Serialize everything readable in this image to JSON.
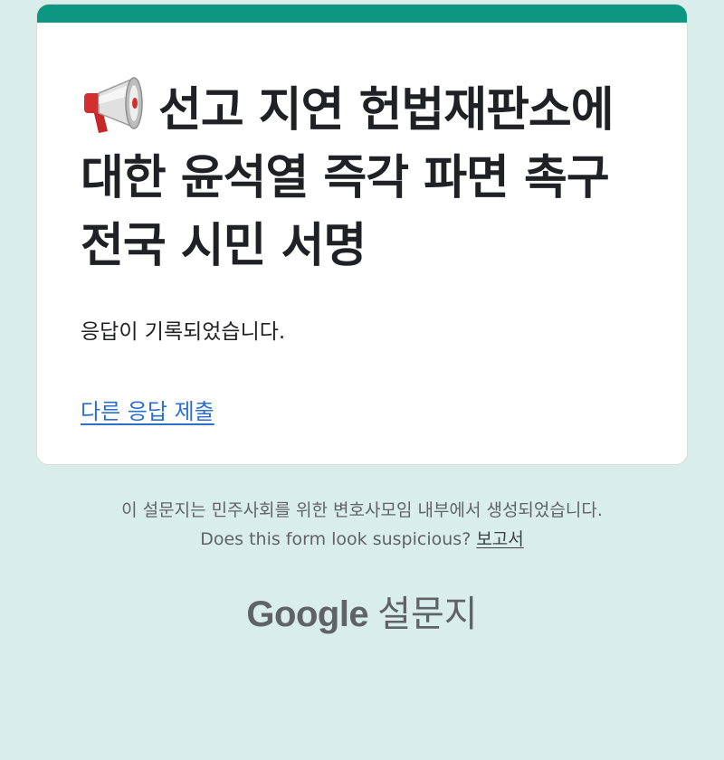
{
  "form": {
    "title_text": "선고 지연 헌법재판소에 대한 윤석열 즉각 파면 촉구 전국 시민 서명",
    "title_icon": "megaphone-icon",
    "confirmation": "응답이 기록되었습니다.",
    "submit_another_label": "다른 응답 제출"
  },
  "footer": {
    "created_by": "이 설문지는 민주사회를 위한 변호사모임 내부에서 생성되었습니다.",
    "suspicious_prompt": "Does this form look suspicious?",
    "report_label": "보고서",
    "brand_google": "Google",
    "brand_product": "설문지"
  },
  "colors": {
    "accent": "#0c9783",
    "background": "#d9eeeb",
    "link": "#2a6fc9"
  }
}
